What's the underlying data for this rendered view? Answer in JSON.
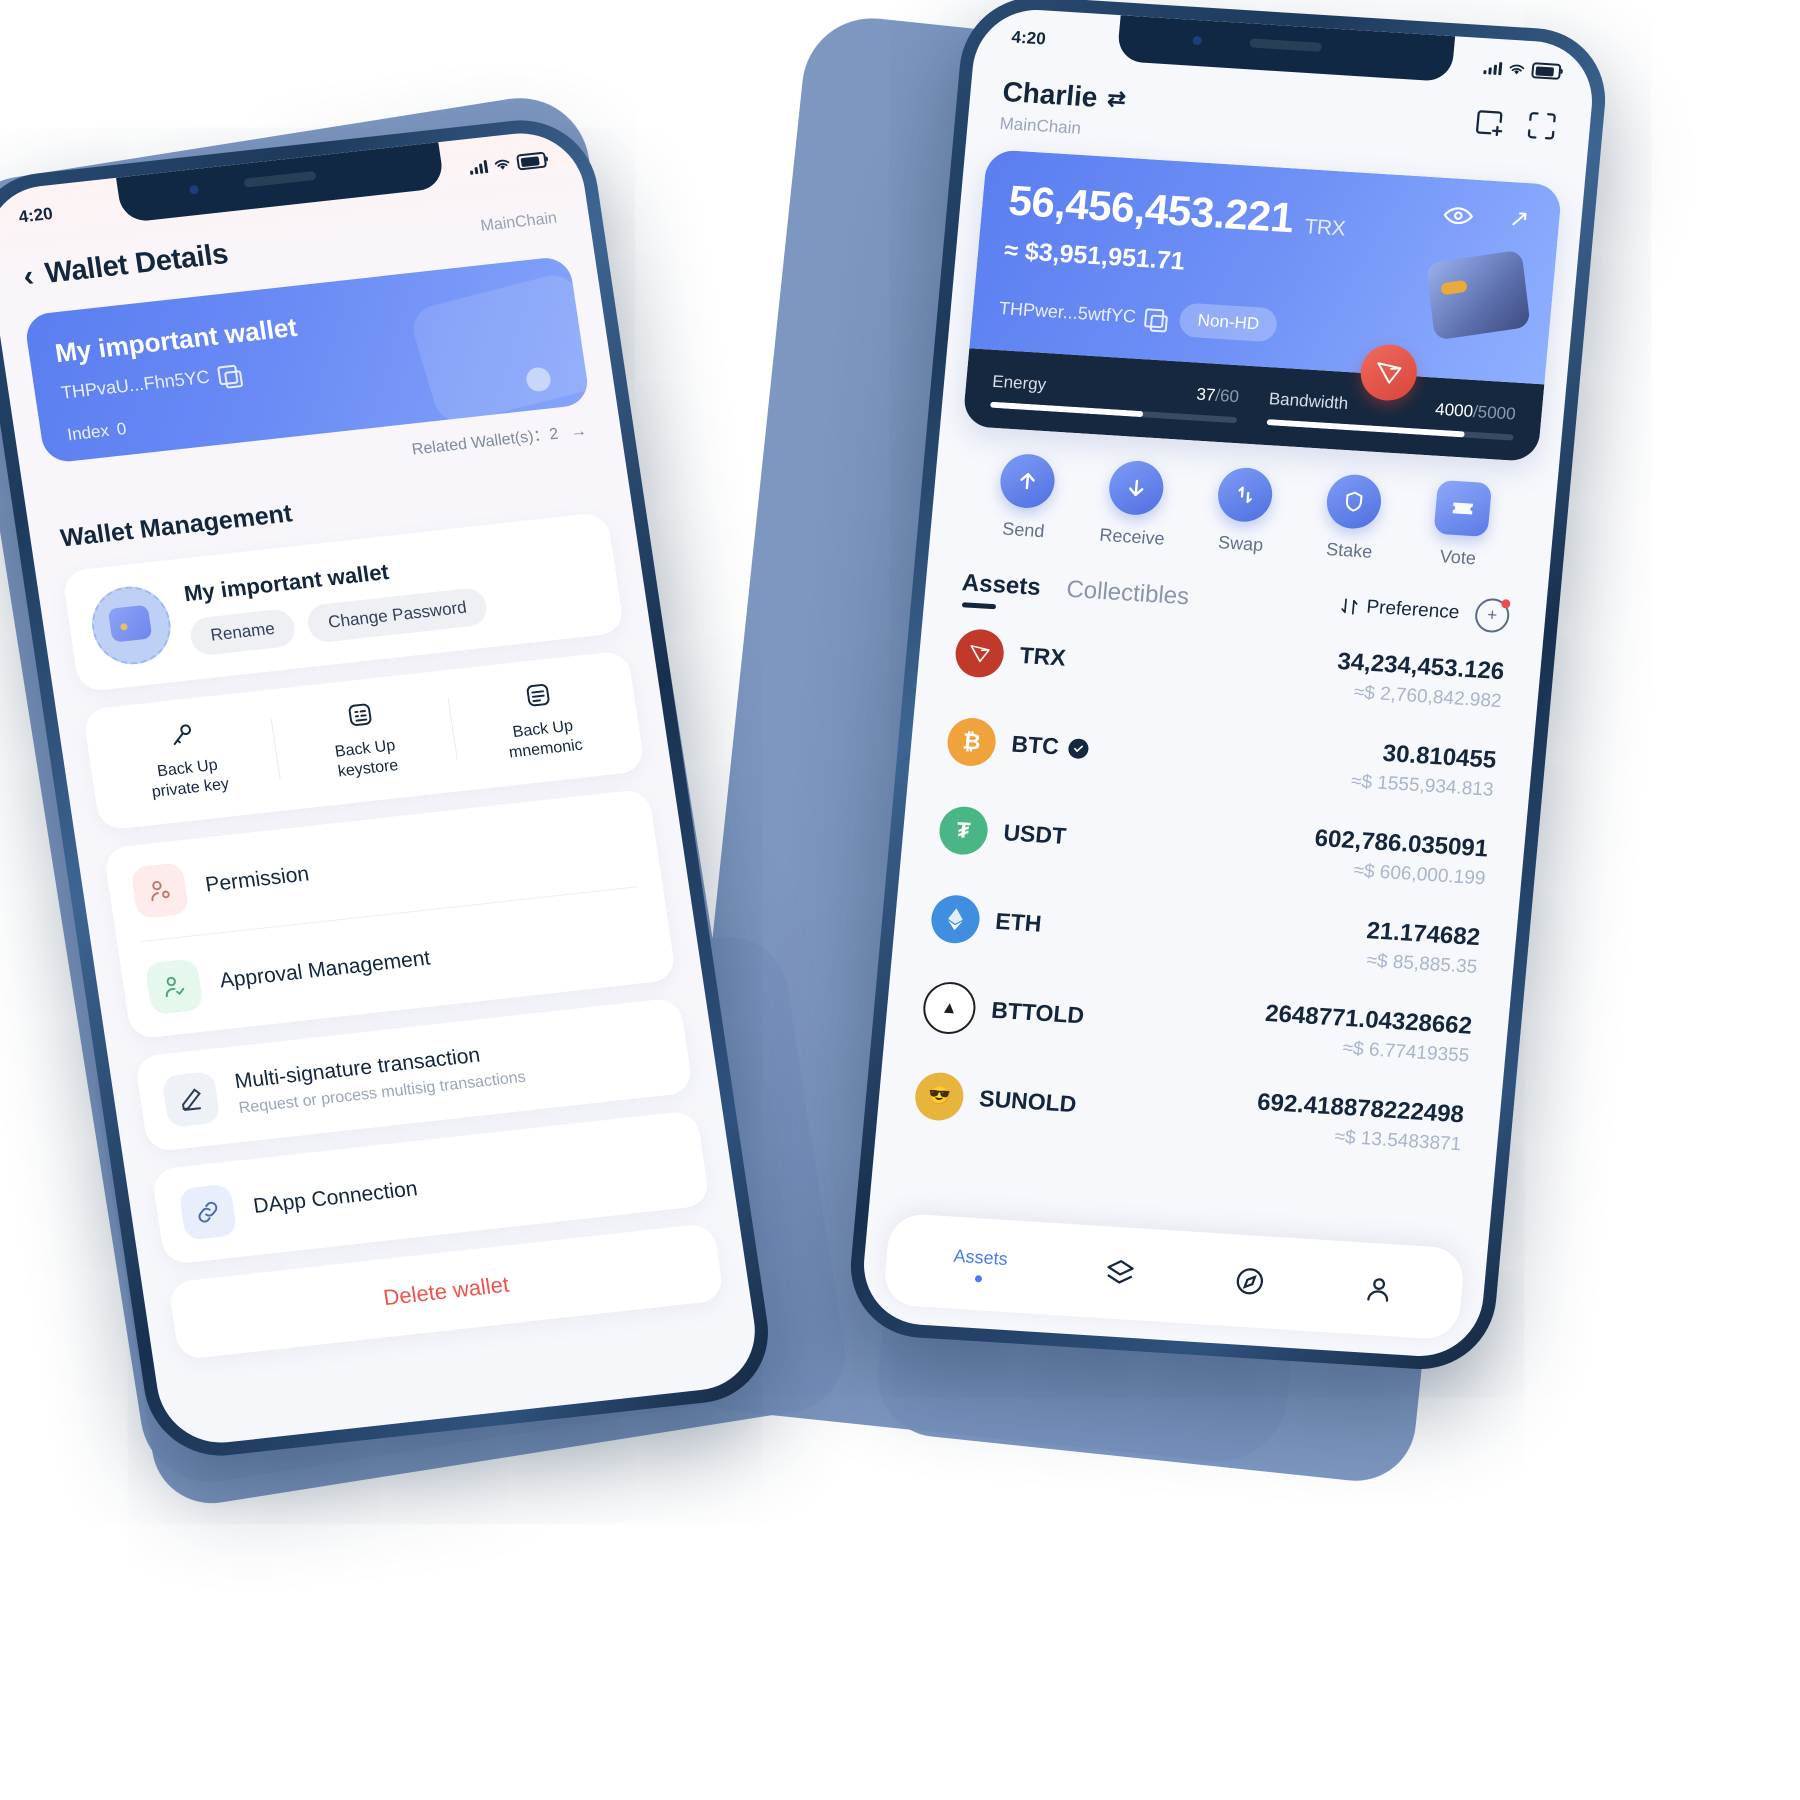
{
  "left_phone": {
    "status": {
      "time": "4:20",
      "signal_icon": "signal-bars-icon",
      "wifi_icon": "wifi-icon",
      "battery_icon": "battery-icon"
    },
    "nav": {
      "back_icon": "chevron-left-icon",
      "title": "Wallet Details",
      "chain": "MainChain"
    },
    "wallet_card": {
      "name": "My important wallet",
      "address": "THPvaU...Fhn5YC",
      "copy_icon": "copy-icon",
      "index_label": "Index",
      "index_value": "0"
    },
    "related": {
      "label": "Related Wallet(s)：2",
      "arrow_icon": "arrow-right-icon"
    },
    "section_title": "Wallet Management",
    "wallet_row": {
      "avatar_icon": "wallet-avatar-icon",
      "name": "My important wallet",
      "rename_label": "Rename",
      "change_password_label": "Change Password"
    },
    "backups": [
      {
        "icon": "key-icon",
        "line1": "Back Up",
        "line2": "private key"
      },
      {
        "icon": "keystore-icon",
        "line1": "Back Up",
        "line2": "keystore"
      },
      {
        "icon": "mnemonic-icon",
        "line1": "Back Up",
        "line2": "mnemonic"
      }
    ],
    "menu": [
      {
        "icon": "permission-user-icon",
        "title": "Permission",
        "subtitle": ""
      },
      {
        "icon": "approval-user-check-icon",
        "title": "Approval Management",
        "subtitle": ""
      },
      {
        "icon": "pencil-icon",
        "title": "Multi-signature transaction",
        "subtitle": "Request or process multisig transactions"
      },
      {
        "icon": "link-icon",
        "title": "DApp Connection",
        "subtitle": ""
      }
    ],
    "delete_label": "Delete wallet",
    "colors": {
      "accent": "#6a8bf5",
      "danger": "#f0534f",
      "ink": "#14263d"
    }
  },
  "right_phone": {
    "status": {
      "time": "4:20",
      "signal_icon": "signal-bars-icon",
      "wifi_icon": "wifi-icon",
      "battery_icon": "battery-icon"
    },
    "header": {
      "account_name": "Charlie",
      "switch_icon": "account-switch-icon",
      "chain": "MainChain",
      "add_icon": "add-wallet-icon",
      "scan_icon": "scan-qr-icon"
    },
    "balance": {
      "amount": "56,456,453.221",
      "unit": "TRX",
      "usd": "≈ $3,951,951.71",
      "address": "THPwer...5wtfYC",
      "copy_icon": "copy-icon",
      "badge": "Non-HD",
      "eye_icon": "eye-icon",
      "share_icon": "arrow-up-right-icon",
      "wallet_icon": "wallet-3d-icon",
      "tron_icon": "tron-logo-icon"
    },
    "resources": [
      {
        "name": "Energy",
        "value": "37",
        "max": "/60",
        "percent": 62
      },
      {
        "name": "Bandwidth",
        "value": "4000",
        "max": "/5000",
        "percent": 80
      }
    ],
    "actions": [
      {
        "icon": "arrow-up-icon",
        "label": "Send"
      },
      {
        "icon": "arrow-down-icon",
        "label": "Receive"
      },
      {
        "icon": "swap-icon",
        "label": "Swap"
      },
      {
        "icon": "shield-icon",
        "label": "Stake"
      },
      {
        "icon": "ticket-icon",
        "label": "Vote"
      }
    ],
    "tabs": [
      {
        "label": "Assets",
        "active": true
      },
      {
        "label": "Collectibles",
        "active": false
      }
    ],
    "preference": {
      "sort_icon": "sort-arrows-icon",
      "label": "Preference",
      "add_token_icon": "add-token-icon"
    },
    "assets": [
      {
        "symbol": "TRX",
        "icon": "tron-logo-icon",
        "color": "#c0392b",
        "verified": false,
        "amount": "34,234,453.126",
        "usd": "≈$ 2,760,842.982"
      },
      {
        "symbol": "BTC",
        "icon": "bitcoin-icon",
        "color": "#f0a33c",
        "verified": true,
        "amount": "30.810455",
        "usd": "≈$ 1555,934.813"
      },
      {
        "symbol": "USDT",
        "icon": "tether-icon",
        "color": "#4bb685",
        "verified": false,
        "amount": "602,786.035091",
        "usd": "≈$ 606,000.199"
      },
      {
        "symbol": "ETH",
        "icon": "ethereum-icon",
        "color": "#3f8ee0",
        "verified": false,
        "amount": "21.174682",
        "usd": "≈$ 85,885.35"
      },
      {
        "symbol": "BTTOLD",
        "icon": "bittorrent-icon",
        "color": "#1f1f1f",
        "verified": false,
        "amount": "2648771.04328662",
        "usd": "≈$ 6.77419355"
      },
      {
        "symbol": "SUNOLD",
        "icon": "sun-token-icon",
        "color": "#e8b53c",
        "verified": false,
        "amount": "692.418878222498",
        "usd": "≈$ 13.5483871"
      }
    ],
    "tabbar": [
      {
        "icon": "assets-icon",
        "label": "Assets",
        "active": true
      },
      {
        "icon": "layers-icon",
        "label": "",
        "active": false
      },
      {
        "icon": "explore-icon",
        "label": "",
        "active": false
      },
      {
        "icon": "profile-icon",
        "label": "",
        "active": false
      }
    ],
    "colors": {
      "accent": "#4a7cf0",
      "dark": "#16283f"
    }
  }
}
